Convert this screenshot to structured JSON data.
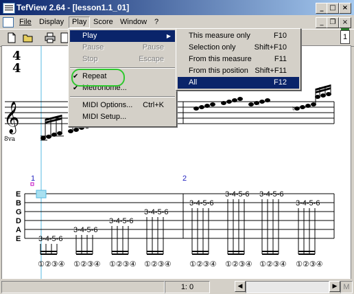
{
  "window": {
    "title": "TefView 2.64 - [lesson1.1_01]"
  },
  "window_buttons": {
    "minimize": "_",
    "maximize": "□",
    "close": "×"
  },
  "mdi_buttons": {
    "minimize": "_",
    "restore": "❐",
    "close": "×"
  },
  "menubar": {
    "items": [
      "File",
      "Display",
      "Play",
      "Score",
      "Window",
      "?"
    ]
  },
  "toolbar": {
    "page_number": "1"
  },
  "play_menu": {
    "items": [
      {
        "label": "Play",
        "shortcut": "",
        "state": "highlighted",
        "submenu": true
      },
      {
        "label": "Pause",
        "shortcut": "Pause",
        "state": "disabled"
      },
      {
        "label": "Stop",
        "shortcut": "Escape",
        "state": "disabled"
      },
      {
        "label": "Repeat",
        "shortcut": "",
        "state": "checked"
      },
      {
        "label": "Metronome...",
        "shortcut": "",
        "state": "checked"
      },
      {
        "label": "MIDI Options...",
        "shortcut": "Ctrl+K",
        "state": "normal"
      },
      {
        "label": "MIDI Setup...",
        "shortcut": "",
        "state": "normal"
      }
    ]
  },
  "play_submenu": {
    "items": [
      {
        "label": "This measure only",
        "shortcut": "F10"
      },
      {
        "label": "Selection only",
        "shortcut": "Shift+F10"
      },
      {
        "label": "From this measure",
        "shortcut": "F11"
      },
      {
        "label": "From this position",
        "shortcut": "Shift+F11"
      },
      {
        "label": "All",
        "shortcut": "F12",
        "state": "highlighted"
      }
    ]
  },
  "score": {
    "time_signature": {
      "top": "4",
      "bottom": "4"
    },
    "clef_octave": "8va",
    "measure_numbers": [
      "1",
      "2"
    ],
    "tab_strings": [
      "E",
      "B",
      "G",
      "D",
      "A",
      "E"
    ],
    "tab_groups_measure1": [
      "3-4-5-6",
      "3-4-5-6",
      "3-4-5-6",
      "3-4-5-6",
      "3-4-5-6"
    ],
    "tab_groups_measure2": [
      "3-4-5-6",
      "3-4-5-6",
      "3-4-5-6",
      "3-4-5-6"
    ],
    "finger_digits": [
      "①",
      "②",
      "③",
      "④"
    ]
  },
  "statusbar": {
    "position": "1: 0",
    "mode": "M"
  },
  "colors": {
    "title_start": "#0a246a",
    "title_end": "#a6caf0",
    "highlight": "#0a246a",
    "cursor_line": "#55b8e0",
    "repeat_circle": "#2ec82e",
    "measure_number": "#2020c0"
  }
}
